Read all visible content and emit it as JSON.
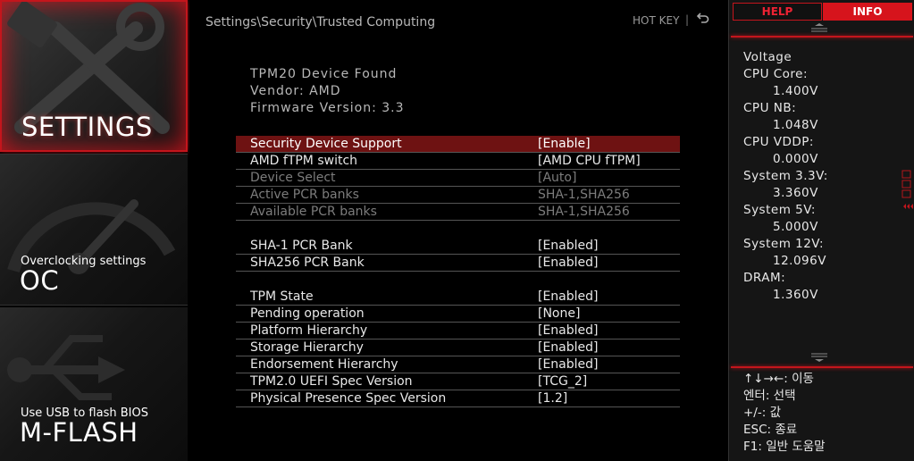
{
  "sidebar": {
    "settings": {
      "title": "SETTINGS"
    },
    "oc": {
      "subtitle": "Overclocking settings",
      "title": "OC"
    },
    "mflash": {
      "subtitle": "Use USB to flash BIOS",
      "title": "M-FLASH"
    }
  },
  "header": {
    "breadcrumb": "Settings\\Security\\Trusted Computing",
    "hotkey": "HOT KEY",
    "separator": "|"
  },
  "device_info": [
    "TPM20  Device  Found",
    "Vendor:  AMD",
    "Firmware  Version:  3.3"
  ],
  "settings_rows": [
    {
      "label": "Security Device Support",
      "value": "[Enable]",
      "state": "selected"
    },
    {
      "label": "AMD fTPM switch",
      "value": "[AMD CPU fTPM]",
      "state": "normal"
    },
    {
      "label": "Device Select",
      "value": "[Auto]",
      "state": "disabled"
    },
    {
      "label": "Active PCR banks",
      "value": "SHA-1,SHA256",
      "state": "disabled"
    },
    {
      "label": "Available PCR banks",
      "value": "SHA-1,SHA256",
      "state": "disabled"
    },
    {
      "label": "SHA-1 PCR Bank",
      "value": "[Enabled]",
      "state": "normal"
    },
    {
      "label": "SHA256 PCR Bank",
      "value": "[Enabled]",
      "state": "normal"
    },
    {
      "label": "TPM State",
      "value": "[Enabled]",
      "state": "normal"
    },
    {
      "label": "Pending operation",
      "value": "[None]",
      "state": "normal"
    },
    {
      "label": "Platform Hierarchy",
      "value": "[Enabled]",
      "state": "normal"
    },
    {
      "label": "Storage Hierarchy",
      "value": "[Enabled]",
      "state": "normal"
    },
    {
      "label": "Endorsement Hierarchy",
      "value": "[Enabled]",
      "state": "normal"
    },
    {
      "label": "TPM2.0 UEFI Spec Version",
      "value": "[TCG_2]",
      "state": "normal"
    },
    {
      "label": "Physical Presence Spec Version",
      "value": "[1.2]",
      "state": "normal"
    }
  ],
  "right_panel": {
    "tabs": {
      "help": "HELP",
      "info": "INFO"
    },
    "voltage_title": "Voltage",
    "voltages": [
      {
        "label": "CPU  Core:",
        "value": "1.400V"
      },
      {
        "label": "CPU  NB:",
        "value": "1.048V"
      },
      {
        "label": "CPU  VDDP:",
        "value": "0.000V"
      },
      {
        "label": "System  3.3V:",
        "value": "3.360V"
      },
      {
        "label": "System  5V:",
        "value": "5.000V"
      },
      {
        "label": "System  12V:",
        "value": "12.096V"
      },
      {
        "label": "DRAM:",
        "value": "1.360V"
      }
    ],
    "key_help": [
      "↑↓→←:  이동",
      "엔터:  선택",
      "+/-:  값",
      "ESC:  종료",
      "F1:  일반  도움말"
    ]
  },
  "colors": {
    "accent": "#d6141c",
    "selected_row": "#6e1212",
    "disabled_text": "#7c7c7c"
  },
  "icons": [
    "wrench-screwdriver-icon",
    "speedometer-icon",
    "usb-icon",
    "back-arrow-icon",
    "scroll-up-icon",
    "scroll-down-icon"
  ]
}
